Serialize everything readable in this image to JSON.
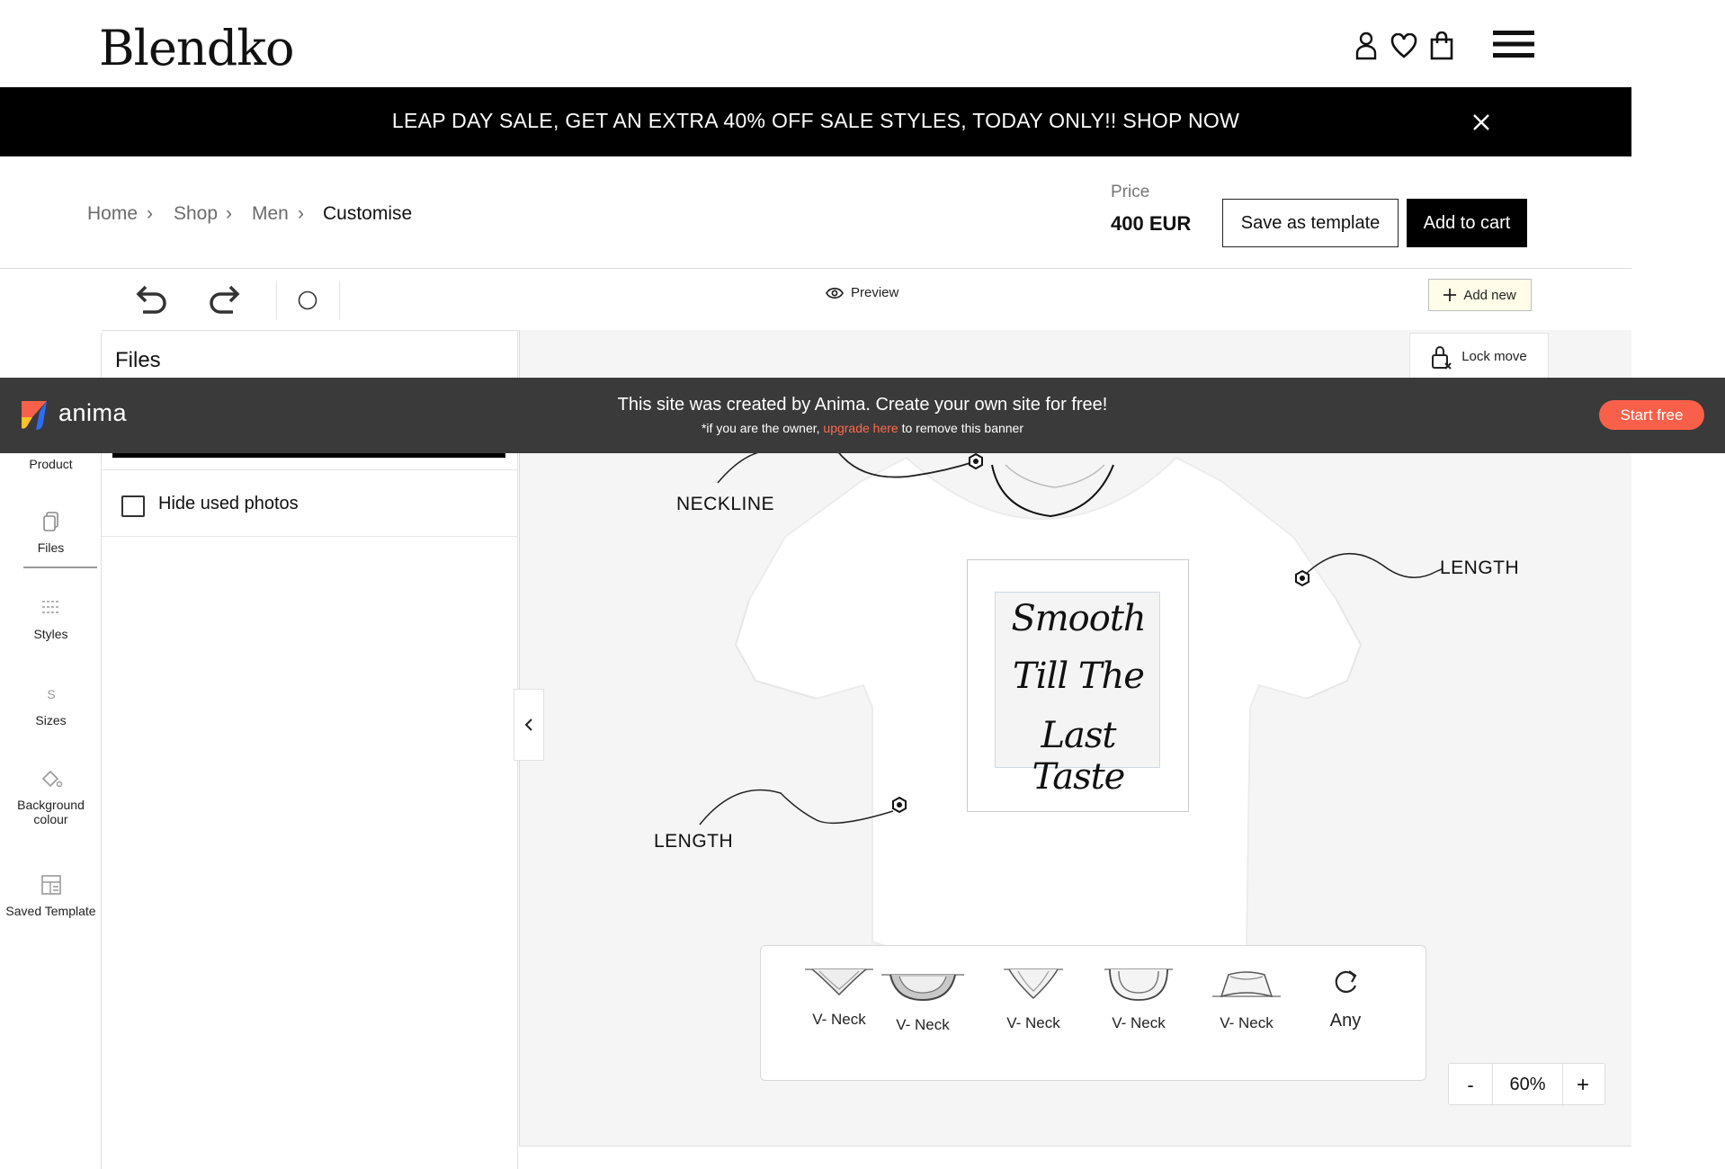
{
  "header": {
    "logo_text": "Blendko",
    "icons": [
      "user-icon",
      "heart-icon",
      "bag-icon",
      "menu-icon"
    ]
  },
  "promo": {
    "text": "LEAP DAY SALE, GET AN EXTRA 40% OFF SALE STYLES, TODAY ONLY!! SHOP NOW"
  },
  "breadcrumb": {
    "items": [
      "Home",
      "Shop",
      "Men"
    ],
    "current": "Customise"
  },
  "pricing": {
    "label": "Price",
    "value": "400 EUR",
    "save_template_label": "Save as template",
    "add_to_cart_label": "Add to cart"
  },
  "toolbar": {
    "preview_label": "Preview",
    "add_new_label": "Add new",
    "lock_move_label": "Lock move"
  },
  "sidebar": {
    "items": [
      {
        "label": "Product",
        "icon": "tshirt-icon"
      },
      {
        "label": "Files",
        "icon": "files-icon",
        "active": true
      },
      {
        "label": "Styles",
        "icon": "styles-icon"
      },
      {
        "label": "Sizes",
        "icon": "sizes-icon"
      },
      {
        "label": "Background colour",
        "icon": "paint-bucket-icon"
      },
      {
        "label": "Saved Template",
        "icon": "template-icon"
      }
    ]
  },
  "files_panel": {
    "title": "Files",
    "hide_used_label": "Hide used photos",
    "hide_used_checked": false
  },
  "canvas": {
    "annotations": {
      "neckline": "NECKLINE",
      "length_right": "LENGTH",
      "length_left": "LENGTH"
    },
    "design_lines": [
      "Smooth",
      "Till The",
      "Last Taste"
    ]
  },
  "neckline_options": [
    {
      "label": "V- Neck"
    },
    {
      "label": "V- Neck",
      "selected": true
    },
    {
      "label": "V- Neck"
    },
    {
      "label": "V- Neck"
    },
    {
      "label": "V- Neck"
    },
    {
      "label": "Any"
    }
  ],
  "zoom": {
    "minus_label": "-",
    "value": "60%",
    "plus_label": "+"
  },
  "anima_banner": {
    "brand": "anima",
    "main_text": "This site was created by Anima. Create your own site for free!",
    "sub_prefix": "*if you are the owner, ",
    "sub_link": "upgrade here",
    "sub_suffix": " to remove this banner",
    "cta_label": "Start free"
  },
  "colors": {
    "promo_bg": "#000000",
    "canvas_bg": "#f5f5f5",
    "anima_bg": "#3a3a3a",
    "anima_cta": "#f9604a",
    "add_new_bg": "#fffde9"
  }
}
